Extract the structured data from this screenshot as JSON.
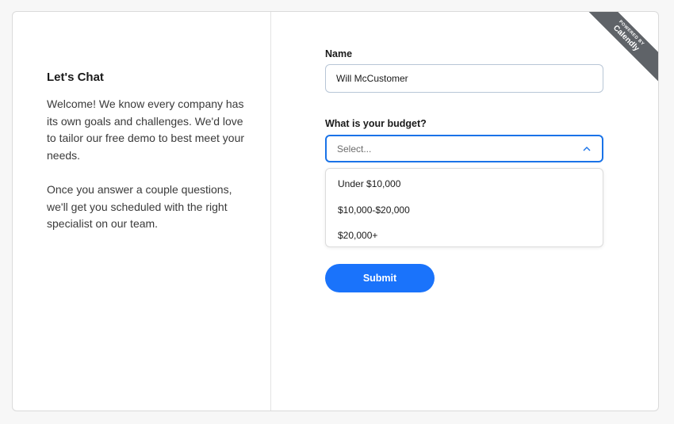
{
  "left": {
    "title": "Let's Chat",
    "paragraph1": "Welcome! We know every company has its own goals and challenges. We'd love to tailor our free demo to best meet your needs.",
    "paragraph2": "Once you answer a couple questions, we'll get you scheduled with the right specialist on our team."
  },
  "form": {
    "name_label": "Name",
    "name_value": "Will McCustomer",
    "budget_label": "What is your budget?",
    "budget_placeholder": "Select...",
    "budget_options": [
      "Under $10,000",
      "$10,000-$20,000",
      "$20,000+"
    ],
    "submit_label": "Submit"
  },
  "badge": {
    "small": "POWERED BY",
    "brand": "Calendly"
  },
  "colors": {
    "accent": "#1a73fb",
    "ribbon": "#5f6368"
  },
  "icons": {
    "select_toggle": "chevron-up-icon"
  }
}
